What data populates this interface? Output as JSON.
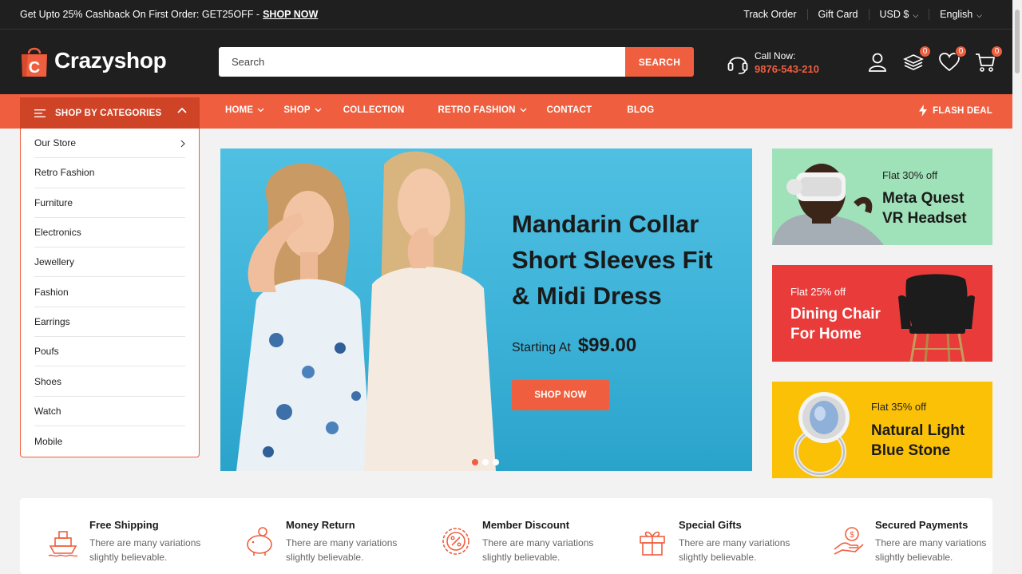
{
  "topbar": {
    "promo_text": "Get Upto 25% Cashback On First Order: GET25OFF -",
    "promo_link": "SHOP NOW",
    "links": [
      "Track Order",
      "Gift Card",
      "USD $",
      "English"
    ]
  },
  "header": {
    "logo_letter": "C",
    "logo_text": "Crazyshop",
    "search_placeholder": "Search",
    "search_button": "SEARCH",
    "call_label": "Call Now:",
    "call_number": "9876-543-210",
    "compare_count": "0",
    "wishlist_count": "0",
    "cart_count": "0"
  },
  "nav": {
    "categories_label": "SHOP BY CATEGORIES",
    "items": [
      "HOME",
      "SHOP",
      "COLLECTION",
      "RETRO FASHION",
      "CONTACT",
      "BLOG"
    ],
    "flash_deal": "FLASH DEAL"
  },
  "categories": [
    "Our Store",
    "Retro Fashion",
    "Furniture",
    "Electronics",
    "Jewellery",
    "Fashion",
    "Earrings",
    "Poufs",
    "Shoes",
    "Watch",
    "Mobile"
  ],
  "hero": {
    "title_lines": [
      "Mandarin Collar",
      "Short Sleeves Fit",
      "& Midi Dress"
    ],
    "price_label": "Starting At",
    "price": "$99.00",
    "button": "SHOP NOW",
    "slide_count": 3,
    "active_slide": 1
  },
  "promos": [
    {
      "offer": "Flat 30% off",
      "title_lines": [
        "Meta Quest",
        "VR Headset"
      ]
    },
    {
      "offer": "Flat 25% off",
      "title_lines": [
        "Dining Chair",
        "For Home"
      ]
    },
    {
      "offer": "Flat 35% off",
      "title_lines": [
        "Natural Light",
        "Blue Stone"
      ]
    }
  ],
  "features": [
    {
      "title": "Free Shipping",
      "desc": "There are many variations slightly believable.",
      "icon": "ship-icon"
    },
    {
      "title": "Money Return",
      "desc": "There are many variations slightly believable.",
      "icon": "piggy-bank-icon"
    },
    {
      "title": "Member Discount",
      "desc": "There are many variations slightly believable.",
      "icon": "discount-badge-icon"
    },
    {
      "title": "Special Gifts",
      "desc": "There are many variations slightly believable.",
      "icon": "gift-icon"
    },
    {
      "title": "Secured Payments",
      "desc": "There are many variations slightly believable.",
      "icon": "secure-payment-icon"
    }
  ],
  "colors": {
    "accent": "#ef5f3f",
    "dark": "#1f1f1f",
    "promo_green": "#9fe1b9",
    "promo_red": "#e83b3a",
    "promo_yellow": "#fbc107"
  }
}
